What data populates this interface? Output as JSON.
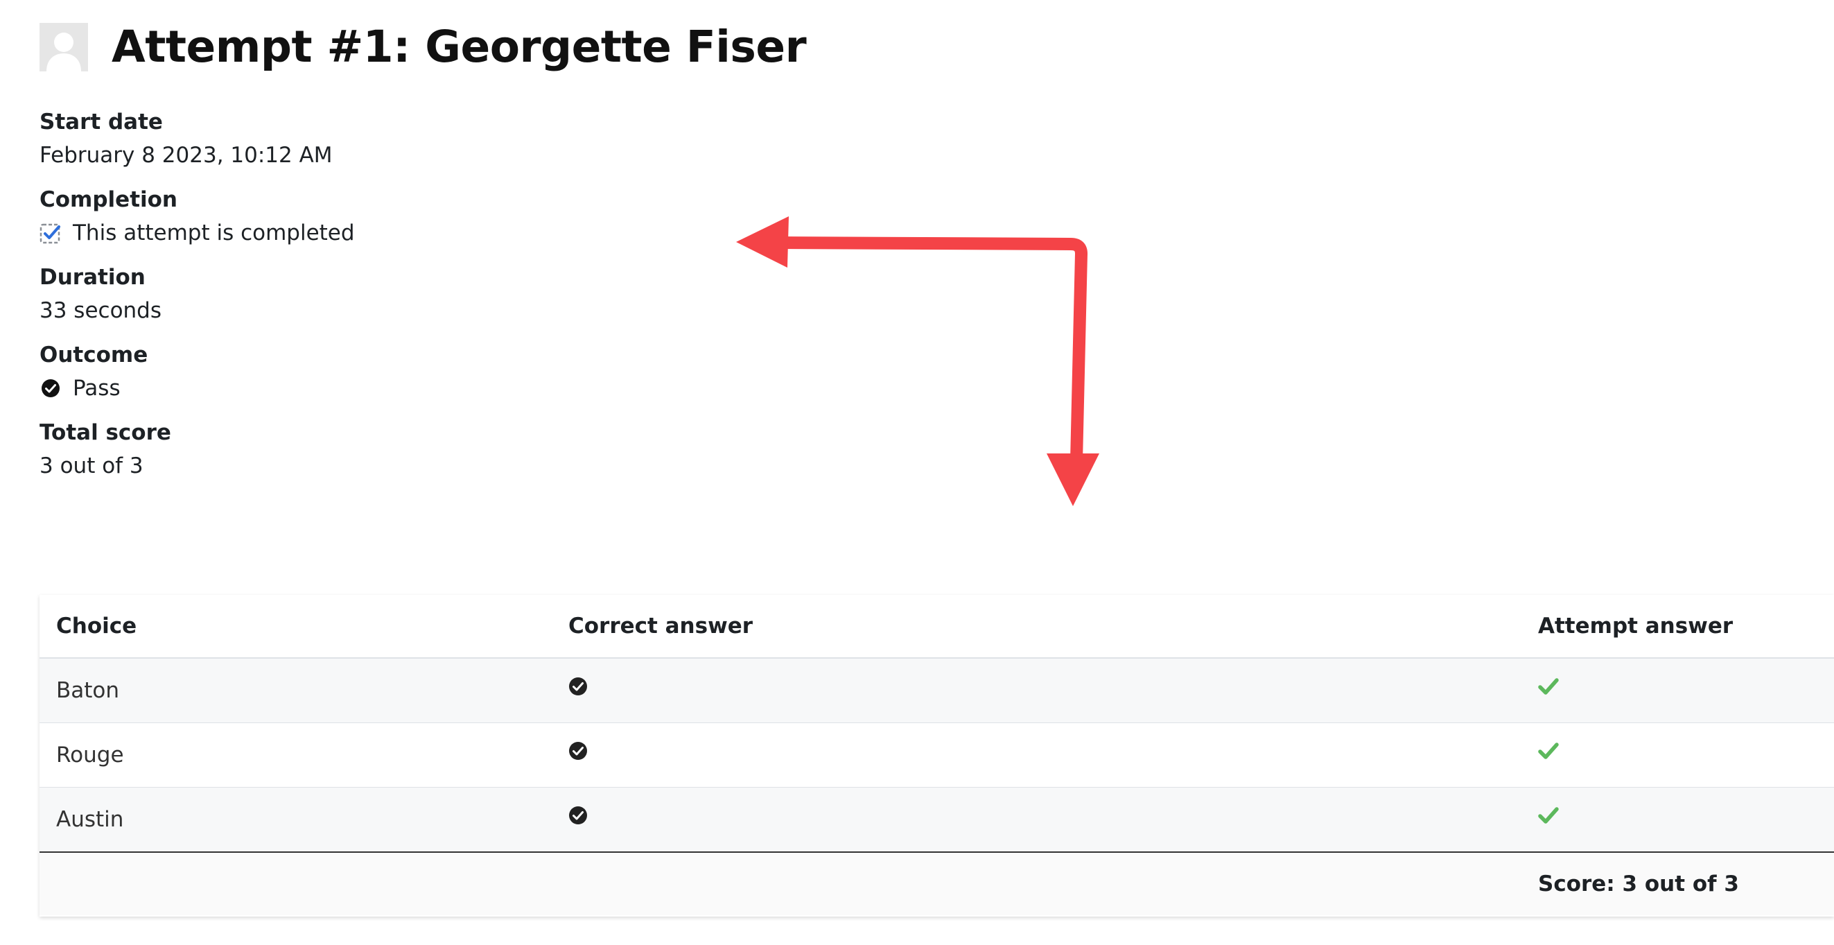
{
  "header": {
    "title": "Attempt #1: Georgette Fiser",
    "avatar_icon": "user-avatar-placeholder-icon"
  },
  "details": {
    "start_date": {
      "label": "Start date",
      "value": "February 8 2023, 10:12 AM"
    },
    "completion": {
      "label": "Completion",
      "value": "This attempt is completed",
      "icon": "completion-checkbox-icon"
    },
    "duration": {
      "label": "Duration",
      "value": "33 seconds"
    },
    "outcome": {
      "label": "Outcome",
      "value": "Pass",
      "icon": "pass-circle-check-icon"
    },
    "total_score": {
      "label": "Total score",
      "value": "3 out of 3"
    }
  },
  "table": {
    "headers": [
      "Choice",
      "Correct answer",
      "Attempt answer"
    ],
    "rows": [
      {
        "choice": "Baton",
        "correct": true,
        "attempt": true
      },
      {
        "choice": "Rouge",
        "correct": true,
        "attempt": true
      },
      {
        "choice": "Austin",
        "correct": true,
        "attempt": true
      }
    ],
    "footer_score": "Score: 3 out of 3",
    "correct_icon": "circle-check-icon",
    "attempt_icon": "green-check-icon"
  },
  "colors": {
    "annotation_arrow": "#f44347",
    "check_green": "#5cb85c",
    "checkbox_blue": "#2f6fdb",
    "text": "#1d2125"
  }
}
